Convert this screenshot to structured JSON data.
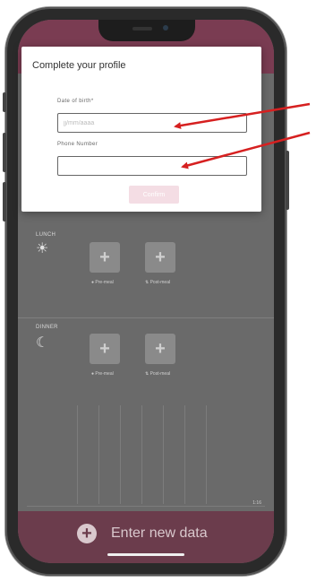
{
  "modal": {
    "title": "Complete your profile",
    "dob_label": "Date of birth*",
    "dob_placeholder": "jj/mm/aaaa",
    "dob_value": "",
    "phone_label": "Phone Number",
    "phone_value": "",
    "confirm_label": "Confirm"
  },
  "meals": [
    {
      "label": "LUNCH",
      "icon": "sun-icon",
      "pre_label": "Pre-meal",
      "post_label": "Post-meal"
    },
    {
      "label": "DINNER",
      "icon": "moon-icon",
      "pre_label": "Pre-meal",
      "post_label": "Post-meal"
    }
  ],
  "add_glyph": "+",
  "chart": {
    "tick_label": "1:16"
  },
  "bottom_bar": {
    "label": "Enter new data"
  },
  "colors": {
    "brand": "#7a3c52",
    "annotation_arrow": "#d62020",
    "confirm_disabled": "#f4dde4"
  }
}
